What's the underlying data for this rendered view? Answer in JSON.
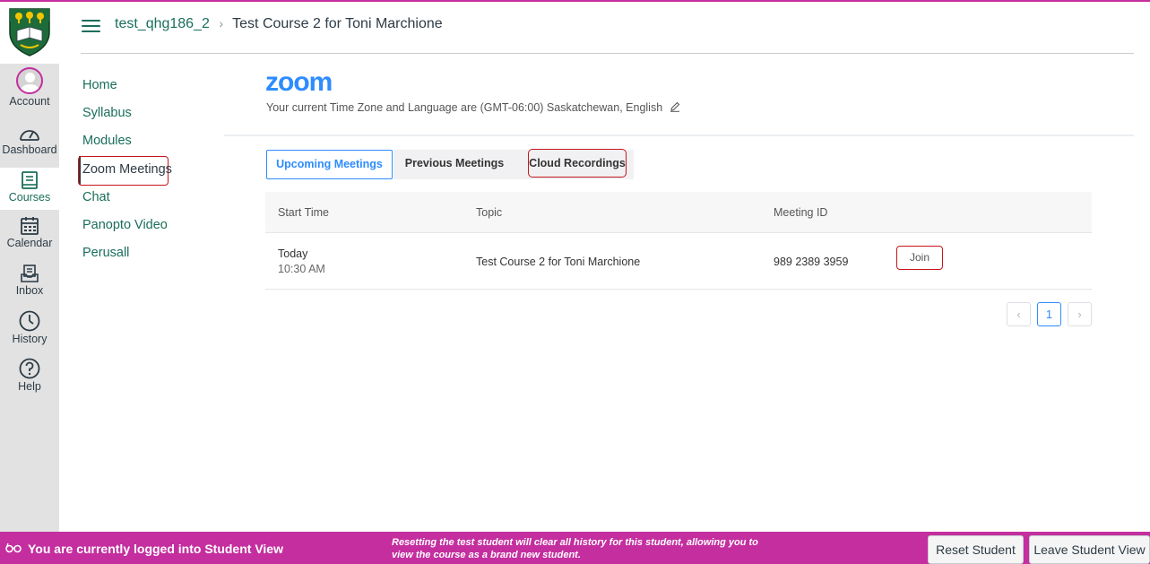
{
  "header": {
    "course_code": "test_qhg186_2",
    "separator": "›",
    "current_page": "Test Course 2 for Toni Marchione"
  },
  "global_nav": {
    "items": [
      {
        "label": "Account",
        "icon": "avatar-icon"
      },
      {
        "label": "Dashboard",
        "icon": "dashboard-icon"
      },
      {
        "label": "Courses",
        "icon": "courses-icon"
      },
      {
        "label": "Calendar",
        "icon": "calendar-icon"
      },
      {
        "label": "Inbox",
        "icon": "inbox-icon"
      },
      {
        "label": "History",
        "icon": "clock-icon"
      },
      {
        "label": "Help",
        "icon": "help-icon"
      }
    ]
  },
  "course_nav": {
    "items": [
      {
        "label": "Home"
      },
      {
        "label": "Syllabus"
      },
      {
        "label": "Modules"
      },
      {
        "label": "Zoom Meetings"
      },
      {
        "label": "Chat"
      },
      {
        "label": "Panopto Video"
      },
      {
        "label": "Perusall"
      }
    ]
  },
  "zoom": {
    "logo": "zoom",
    "timezone_text": "Your current Time Zone and Language are (GMT-06:00) Saskatchewan, English",
    "tabs": [
      {
        "label": "Upcoming Meetings"
      },
      {
        "label": "Previous Meetings"
      },
      {
        "label": "Cloud Recordings"
      }
    ],
    "table": {
      "columns": [
        "Start Time",
        "Topic",
        "Meeting ID"
      ],
      "rows": [
        {
          "day": "Today",
          "time": "10:30 AM",
          "topic": "Test Course 2 for Toni Marchione",
          "meeting_id": "989 2389 3959",
          "action": "Join"
        }
      ]
    },
    "pagination": {
      "prev": "‹",
      "current": "1",
      "next": "›"
    }
  },
  "student_view": {
    "message": "You are currently logged into Student View",
    "note": "Resetting the test student will clear all history for this student, allowing you to view the course as a brand new student.",
    "reset_label": "Reset Student",
    "leave_label": "Leave Student View"
  },
  "colors": {
    "accent_pink": "#c42e9f",
    "link_green": "#196e5a",
    "zoom_blue": "#2d8cff",
    "highlight_red": "#c4161c"
  }
}
